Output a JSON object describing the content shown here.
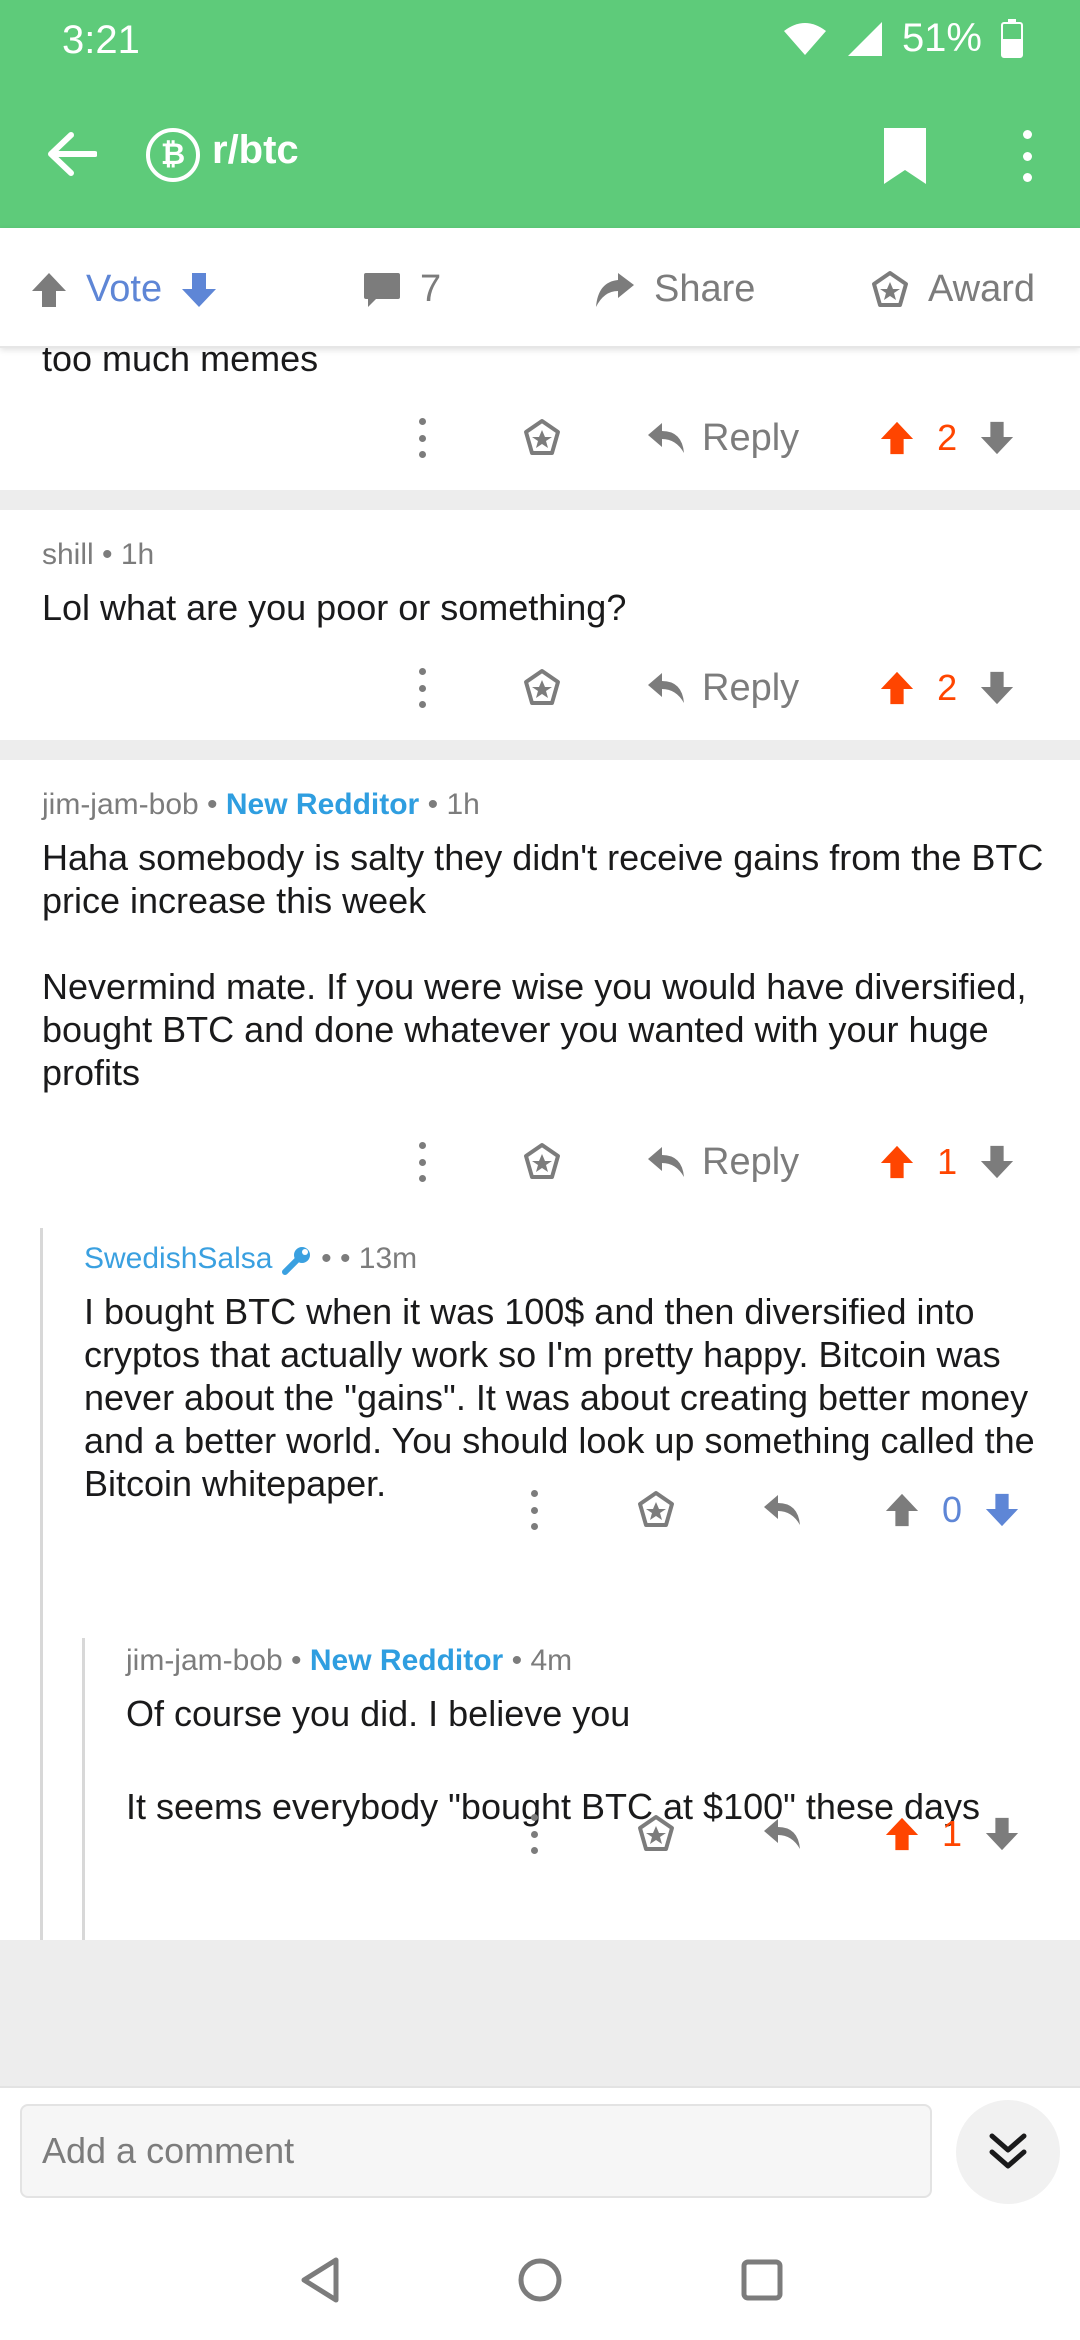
{
  "status": {
    "time": "3:21",
    "battery": "51%"
  },
  "appbar": {
    "subreddit": "r/btc",
    "badge_symbol": "₿"
  },
  "actions": {
    "vote_label": "Vote",
    "comment_count": "7",
    "share_label": "Share",
    "award_label": "Award"
  },
  "comments": [
    {
      "cut_text": "too much memes",
      "reply_label": "Reply",
      "score": "2",
      "vote_state": "up"
    },
    {
      "author": "shill",
      "time": "1h",
      "body": [
        "Lol what are you poor or something?"
      ],
      "reply_label": "Reply",
      "score": "2",
      "vote_state": "up"
    },
    {
      "author": "jim-jam-bob",
      "flair": "New Redditor",
      "time": "1h",
      "body": [
        "Haha somebody is salty they didn't receive gains from the BTC price increase this week",
        "Nevermind mate. If you were wise you would have diversified, bought BTC and done whatever you wanted with your huge profits"
      ],
      "reply_label": "Reply",
      "score": "1",
      "vote_state": "up"
    },
    {
      "author": "SwedishSalsa",
      "time": "13m",
      "body": [
        "I bought BTC when it was 100$ and then diversified into cryptos that actually work so I'm pretty happy. Bitcoin was never about the \"gains\". It was about creating better money and a better world. You should look up something called the Bitcoin whitepaper."
      ],
      "score": "0",
      "vote_state": "down"
    },
    {
      "author": "jim-jam-bob",
      "flair": "New Redditor",
      "time": "4m",
      "body": [
        "Of course you did. I believe you",
        "It seems everybody \"bought BTC at $100\" these days"
      ],
      "score": "1",
      "vote_state": "up"
    }
  ],
  "composer": {
    "placeholder": "Add a comment"
  },
  "colors": {
    "header": "#5ecb7a",
    "upvote": "#ff4500",
    "downvote": "#5e86d6",
    "flair": "#2f9ee0",
    "muted": "#7c7c7c"
  }
}
